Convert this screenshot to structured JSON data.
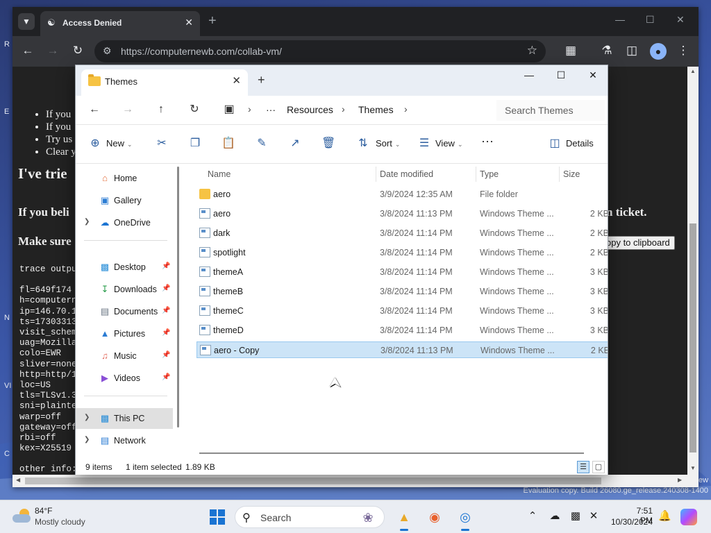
{
  "desktop": {
    "evaluation_text": "Evaluation copy. Build 26080.ge_release.240308-1400",
    "clipped_left": [
      "R",
      "E",
      "N",
      "VI",
      "C"
    ],
    "clipped_right": "ew"
  },
  "browser": {
    "tab_title": "Access Denied",
    "url": "https://computernewb.com/collab-vm/",
    "page": {
      "bullets": [
        "If you",
        "If you",
        "Try us",
        "Clear y"
      ],
      "heading": "I've trie",
      "line_a": "If you beli",
      "line_a_end": "n ticket.",
      "line_b": "Make sure",
      "copy_button": "opy to clipboard",
      "trace_lines": [
        "trace outpu",
        "",
        "fl=649f174",
        "h=computern",
        "ip=146.70.1",
        "ts=17303313",
        "visit_schem",
        "uag=Mozilla",
        "colo=EWR",
        "sliver=none",
        "http=http/1",
        "loc=US",
        "tls=TLSv1.3",
        "sni=plainte",
        "warp=off",
        "gateway=off",
        "rbi=off",
        "kex=X25519",
        "",
        "other info:"
      ]
    }
  },
  "explorer": {
    "tab_title": "Themes",
    "breadcrumb": [
      "Resources",
      "Themes"
    ],
    "search_placeholder": "Search Themes",
    "commands": {
      "new": "New",
      "sort": "Sort",
      "view": "View",
      "details": "Details"
    },
    "sidebar": {
      "top": [
        {
          "label": "Home"
        },
        {
          "label": "Gallery"
        },
        {
          "label": "OneDrive"
        }
      ],
      "pinned": [
        {
          "label": "Desktop"
        },
        {
          "label": "Downloads"
        },
        {
          "label": "Documents"
        },
        {
          "label": "Pictures"
        },
        {
          "label": "Music"
        },
        {
          "label": "Videos"
        }
      ],
      "bottom": [
        {
          "label": "This PC"
        },
        {
          "label": "Network"
        }
      ]
    },
    "columns": {
      "name": "Name",
      "date": "Date modified",
      "type": "Type",
      "size": "Size"
    },
    "files": [
      {
        "name": "aero",
        "date": "3/9/2024 12:35 AM",
        "type": "File folder",
        "size": ""
      },
      {
        "name": "aero",
        "date": "3/8/2024 11:13 PM",
        "type": "Windows Theme ...",
        "size": "2 KB"
      },
      {
        "name": "dark",
        "date": "3/8/2024 11:14 PM",
        "type": "Windows Theme ...",
        "size": "2 KB"
      },
      {
        "name": "spotlight",
        "date": "3/8/2024 11:14 PM",
        "type": "Windows Theme ...",
        "size": "2 KB"
      },
      {
        "name": "themeA",
        "date": "3/8/2024 11:14 PM",
        "type": "Windows Theme ...",
        "size": "3 KB"
      },
      {
        "name": "themeB",
        "date": "3/8/2024 11:14 PM",
        "type": "Windows Theme ...",
        "size": "3 KB"
      },
      {
        "name": "themeC",
        "date": "3/8/2024 11:14 PM",
        "type": "Windows Theme ...",
        "size": "3 KB"
      },
      {
        "name": "themeD",
        "date": "3/8/2024 11:14 PM",
        "type": "Windows Theme ...",
        "size": "3 KB"
      },
      {
        "name": "aero - Copy",
        "date": "3/8/2024 11:13 PM",
        "type": "Windows Theme ...",
        "size": "2 KB"
      }
    ],
    "status": {
      "count": "9 items",
      "selection": "1 item selected",
      "size": "1.89 KB"
    }
  },
  "taskbar": {
    "weather_temp": "84°F",
    "weather_cond": "Mostly cloudy",
    "search_label": "Search",
    "time": "7:51 PM",
    "date": "10/30/2024"
  }
}
